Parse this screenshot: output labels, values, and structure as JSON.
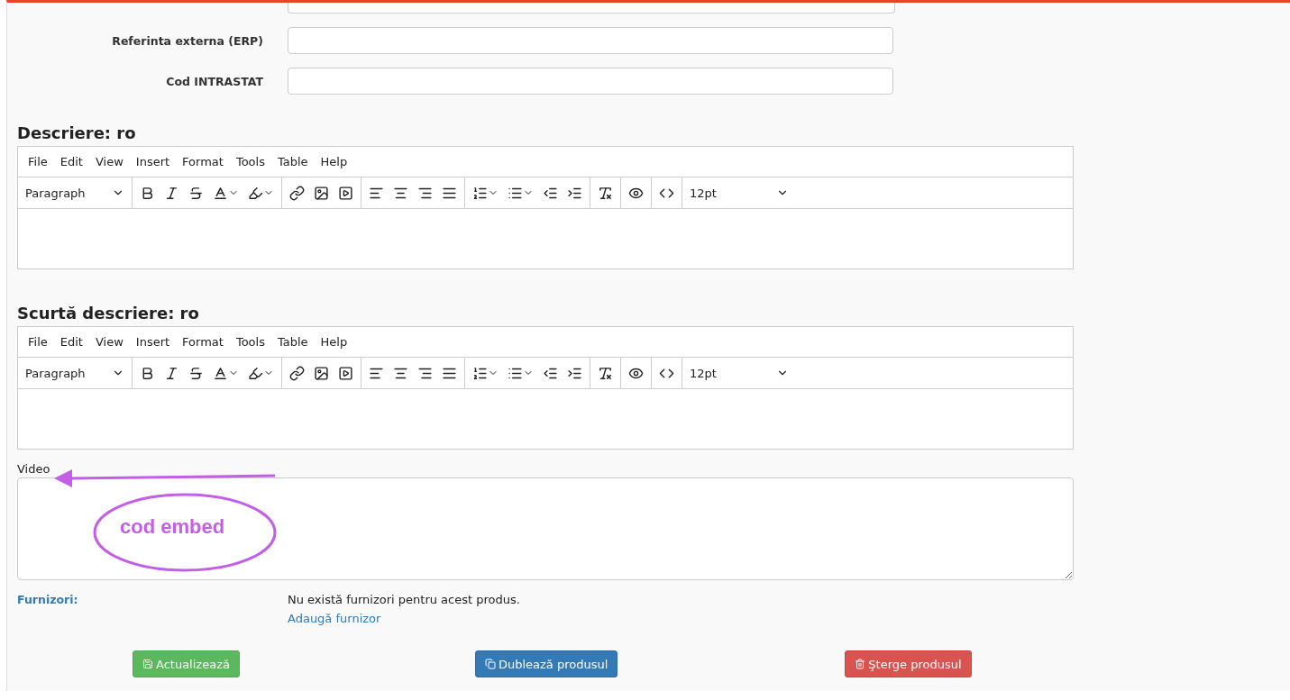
{
  "fields": [
    {
      "label": "Referinta externa (ERP)"
    },
    {
      "label": "Cod INTRASTAT"
    }
  ],
  "editors": [
    {
      "heading": "Descriere: ro",
      "menu": [
        "File",
        "Edit",
        "View",
        "Insert",
        "Format",
        "Tools",
        "Table",
        "Help"
      ],
      "block_format": "Paragraph",
      "font_size": "12pt"
    },
    {
      "heading": "Scurtă descriere: ro",
      "menu": [
        "File",
        "Edit",
        "View",
        "Insert",
        "Format",
        "Tools",
        "Table",
        "Help"
      ],
      "block_format": "Paragraph",
      "font_size": "12pt"
    }
  ],
  "video": {
    "label": "Video",
    "annotation": "cod embed"
  },
  "suppliers": {
    "label": "Furnizori:",
    "empty_text": "Nu există furnizori pentru acest produs.",
    "add_link": "Adaugă furnizor"
  },
  "actions": [
    {
      "kind": "save",
      "label": "Actualizează"
    },
    {
      "kind": "duplicate",
      "label": "Dublează produsul"
    },
    {
      "kind": "delete",
      "label": "Şterge produsul"
    }
  ]
}
